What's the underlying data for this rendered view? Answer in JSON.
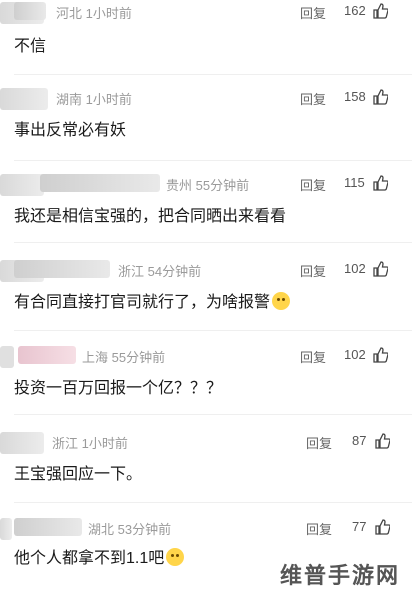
{
  "comments": [
    {
      "location": "河北 1小时前",
      "reply": "回复",
      "likes": "162",
      "text": "不信",
      "emoji": false
    },
    {
      "location": "湖南 1小时前",
      "reply": "回复",
      "likes": "158",
      "text": "事出反常必有妖",
      "emoji": false
    },
    {
      "location": "贵州 55分钟前",
      "reply": "回复",
      "likes": "115",
      "text": "我还是相信宝强的，把合同晒出来看看",
      "emoji": false
    },
    {
      "location": "浙江 54分钟前",
      "reply": "回复",
      "likes": "102",
      "text": "有合同直接打官司就行了，为啥报警",
      "emoji": true
    },
    {
      "location": "上海 55分钟前",
      "reply": "回复",
      "likes": "102",
      "text": "投资一百万回报一个亿？？？",
      "emoji": false
    },
    {
      "location": "浙江 1小时前",
      "reply": "回复",
      "likes": "87",
      "text": "王宝强回应一下。",
      "emoji": false
    },
    {
      "location": "湖北 53分钟前",
      "reply": "回复",
      "likes": "77",
      "text": "他个人都拿不到1.1吧",
      "emoji": true
    }
  ],
  "watermark": "维普手游网"
}
